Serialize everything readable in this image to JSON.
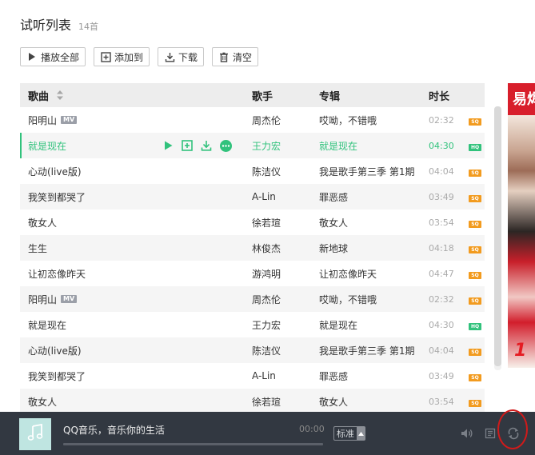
{
  "header": {
    "title": "试听列表",
    "count": "14首"
  },
  "toolbar": {
    "play_all": "播放全部",
    "add_to": "添加到",
    "download": "下载",
    "clear": "清空"
  },
  "table": {
    "columns": {
      "song": "歌曲",
      "singer": "歌手",
      "album": "专辑",
      "duration": "时长"
    },
    "rows": [
      {
        "song": "阳明山",
        "mv": "MV",
        "singer": "周杰伦",
        "album": "哎呦，不错哦",
        "duration": "02:32",
        "quality": "SQ"
      },
      {
        "song": "就是现在",
        "mv": "",
        "singer": "王力宏",
        "album": "就是现在",
        "duration": "04:30",
        "quality": "HQ"
      },
      {
        "song": "心动(live版)",
        "mv": "",
        "singer": "陈洁仪",
        "album": "我是歌手第三季 第1期",
        "duration": "04:04",
        "quality": "SQ"
      },
      {
        "song": "我笑到都哭了",
        "mv": "",
        "singer": "A-Lin",
        "album": "罪恶感",
        "duration": "03:49",
        "quality": "SQ"
      },
      {
        "song": "敬女人",
        "mv": "",
        "singer": "徐若瑄",
        "album": "敬女人",
        "duration": "03:54",
        "quality": "SQ"
      },
      {
        "song": "生生",
        "mv": "",
        "singer": "林俊杰",
        "album": "新地球",
        "duration": "04:18",
        "quality": "SQ"
      },
      {
        "song": "让初恋像昨天",
        "mv": "",
        "singer": "游鸿明",
        "album": "让初恋像昨天",
        "duration": "04:47",
        "quality": "SQ"
      },
      {
        "song": "阳明山",
        "mv": "MV",
        "singer": "周杰伦",
        "album": "哎呦，不错哦",
        "duration": "02:32",
        "quality": "SQ"
      },
      {
        "song": "就是现在",
        "mv": "",
        "singer": "王力宏",
        "album": "就是现在",
        "duration": "04:30",
        "quality": "HQ"
      },
      {
        "song": "心动(live版)",
        "mv": "",
        "singer": "陈洁仪",
        "album": "我是歌手第三季 第1期",
        "duration": "04:04",
        "quality": "SQ"
      },
      {
        "song": "我笑到都哭了",
        "mv": "",
        "singer": "A-Lin",
        "album": "罪恶感",
        "duration": "03:49",
        "quality": "SQ"
      },
      {
        "song": "敬女人",
        "mv": "",
        "singer": "徐若瑄",
        "album": "敬女人",
        "duration": "03:54",
        "quality": "SQ"
      }
    ],
    "active_row_index": 1
  },
  "ad": {
    "headline": "易烬",
    "number": "1"
  },
  "player": {
    "info": "QQ音乐，音乐你的生活",
    "time": "00:00",
    "progress": 0,
    "quality_label": "标准"
  },
  "colors": {
    "accent_green": "#31c27c",
    "sq_badge": "#f29b1f",
    "hq_badge": "#31c27c",
    "player_bg": "#323841",
    "highlight_circle": "#d11a1a"
  },
  "icons": {
    "play": "play-icon",
    "add": "add-box-icon",
    "download": "download-icon",
    "delete": "trash-icon",
    "more": "more-icon",
    "sort": "sort-icon",
    "volume": "volume-icon",
    "lyrics": "lyrics-icon",
    "loop": "loop-icon",
    "music_note": "music-note-icon"
  }
}
